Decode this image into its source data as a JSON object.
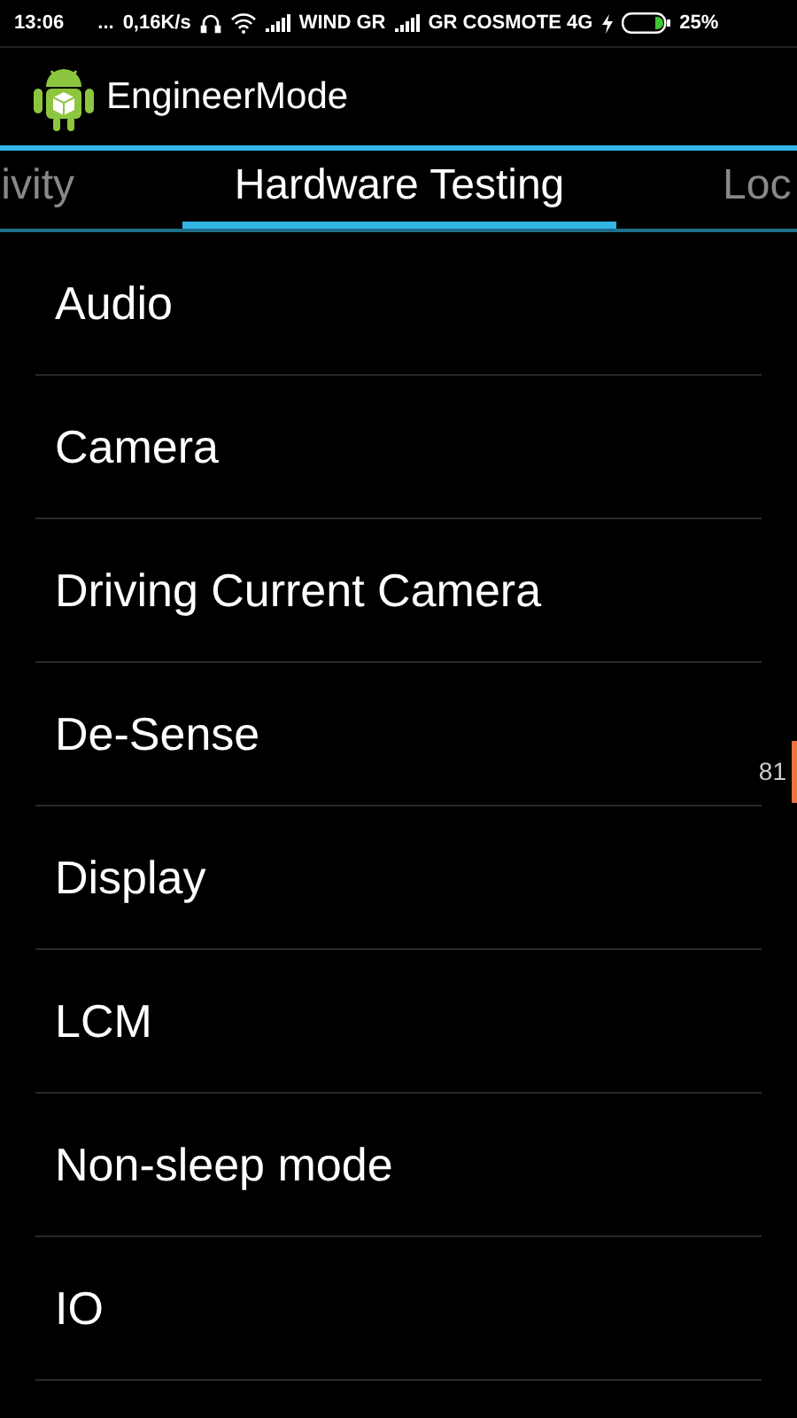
{
  "status_bar": {
    "time": "13:06",
    "dots": "...",
    "speed": "0,16K/s",
    "carrier_1": "WIND GR",
    "carrier_2": "GR COSMOTE 4G",
    "battery": "25%"
  },
  "app_bar": {
    "title": "EngineerMode"
  },
  "tabs": [
    {
      "label": "ivity",
      "selected": false
    },
    {
      "label": "Hardware Testing",
      "selected": true
    },
    {
      "label": "Loc",
      "selected": false
    }
  ],
  "items": [
    "Audio",
    "Camera",
    "Driving Current Camera",
    "De-Sense",
    "Display",
    "LCM",
    "Non-sleep mode",
    "IO"
  ],
  "scroll_label": "81"
}
